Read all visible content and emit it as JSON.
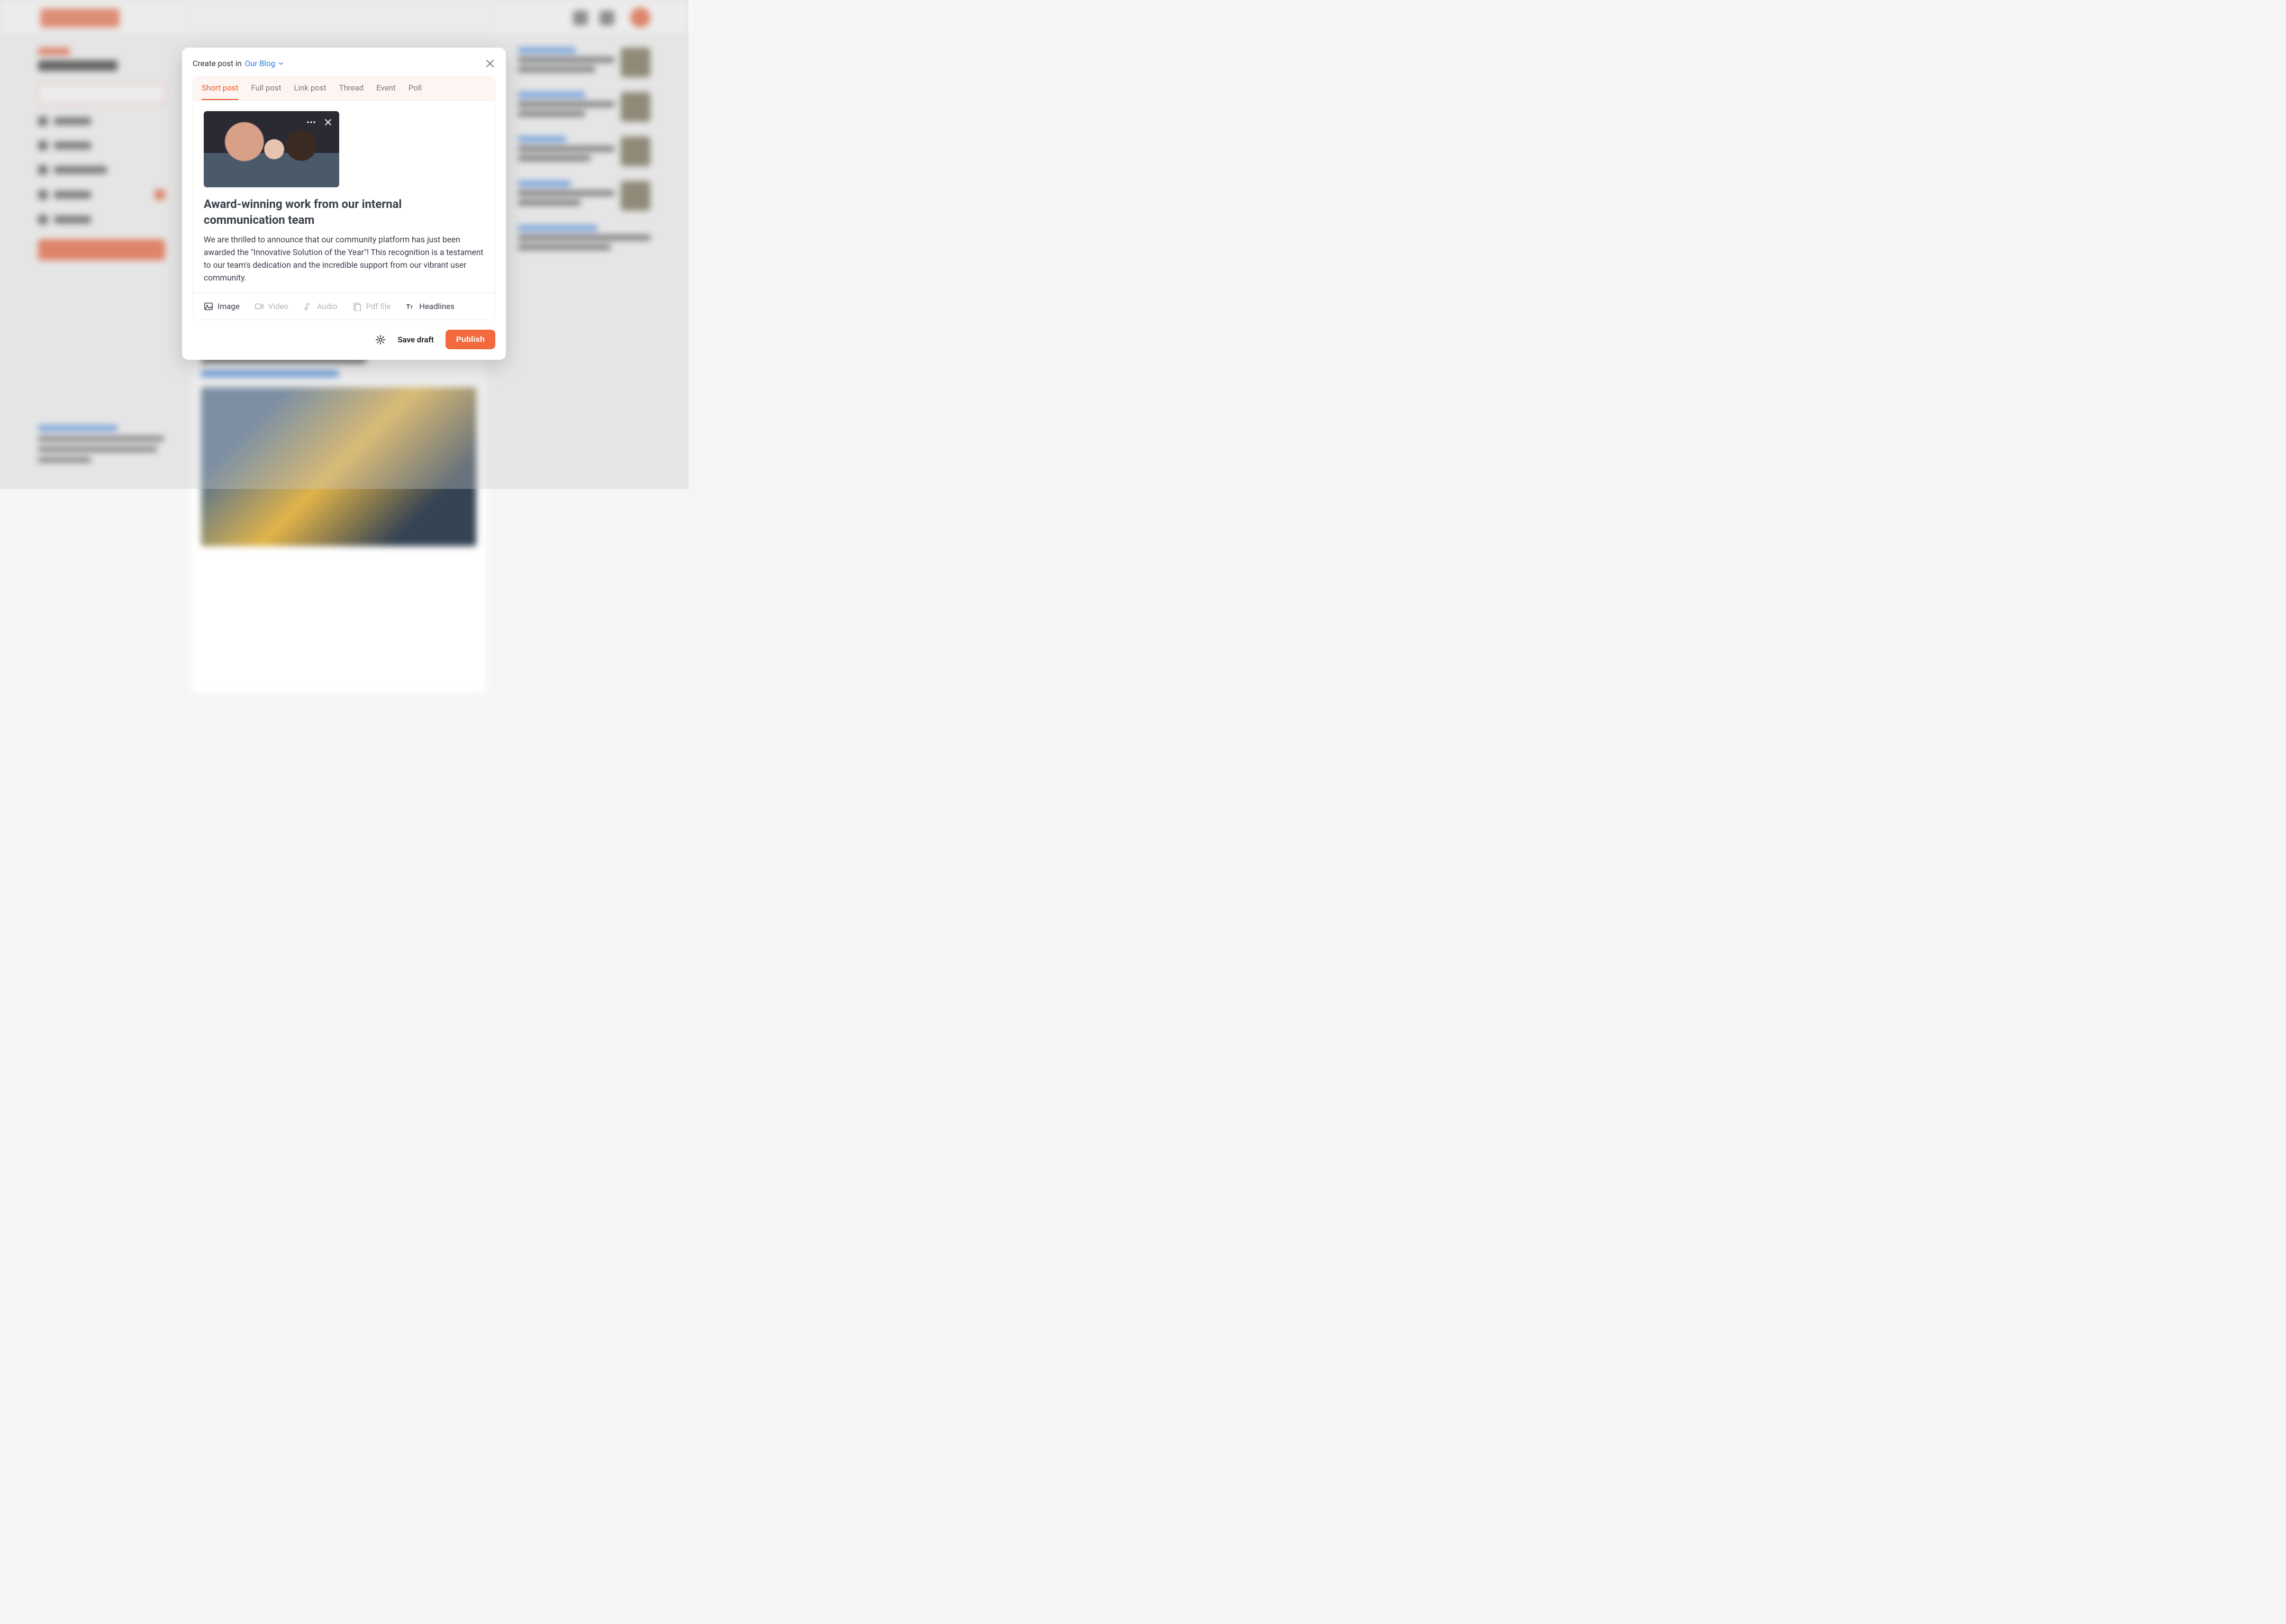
{
  "modal": {
    "header_prefix": "Create post in",
    "blog_name": "Our Blog",
    "tabs": {
      "short_post": "Short post",
      "full_post": "Full post",
      "link_post": "Link post",
      "thread": "Thread",
      "event": "Event",
      "poll": "Poll"
    },
    "active_tab": "short_post",
    "image_alt": "team-high-five-photo",
    "post_title": "Award-winning work from our internal communication team",
    "post_body": "We are thrilled to announce that our community platform has just been awarded the \"Innovative Solution of the Year\"! This recognition is a testament to our team's dedication and the incredible support from our vibrant user community.",
    "attachments": {
      "image": "Image",
      "video": "Video",
      "audio": "Audio",
      "pdf": "Pdf file",
      "headlines": "Headlines"
    },
    "footer": {
      "save_draft": "Save draft",
      "publish": "Publish"
    }
  }
}
